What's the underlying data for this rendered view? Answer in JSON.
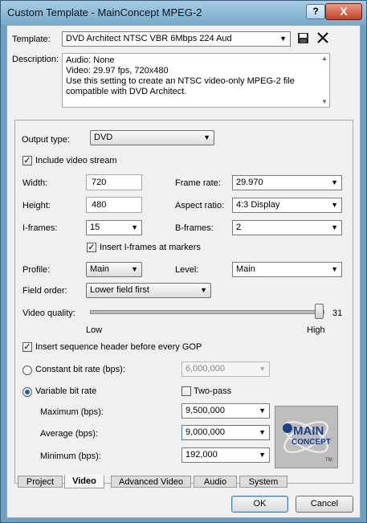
{
  "window": {
    "title": "Custom Template - MainConcept MPEG-2",
    "help_glyph": "?",
    "close_glyph": "X"
  },
  "template": {
    "label": "Template:",
    "value": "DVD Architect NTSC VBR 6Mbps 224 Aud"
  },
  "description": {
    "label": "Description:",
    "lines": [
      "Audio: None",
      "Video: 29.97 fps, 720x480",
      "Use this setting to create an NTSC video-only MPEG-2 file",
      "compatible with DVD Architect."
    ]
  },
  "output_type": {
    "label": "Output type:",
    "value": "DVD"
  },
  "include_video": {
    "label": "Include video stream",
    "checked": true
  },
  "width": {
    "label": "Width:",
    "value": "720"
  },
  "height": {
    "label": "Height:",
    "value": "480"
  },
  "frame_rate": {
    "label": "Frame rate:",
    "value": "29.970"
  },
  "aspect_ratio": {
    "label": "Aspect ratio:",
    "value": "4:3 Display"
  },
  "i_frames": {
    "label": "I-frames:",
    "value": "15"
  },
  "b_frames": {
    "label": "B-frames:",
    "value": "2"
  },
  "insert_iframes": {
    "label": "Insert I-frames at markers",
    "checked": true
  },
  "profile": {
    "label": "Profile:",
    "value": "Main"
  },
  "level": {
    "label": "Level:",
    "value": "Main"
  },
  "field_order": {
    "label": "Field order:",
    "value": "Lower field first"
  },
  "video_quality": {
    "label": "Video quality:",
    "value": "31",
    "low": "Low",
    "high": "High",
    "level_fraction": 1.0
  },
  "insert_seq_header": {
    "label": "Insert sequence header before every GOP",
    "checked": true
  },
  "constant_bitrate": {
    "label": "Constant bit rate (bps):",
    "value": "6,000,000",
    "selected": false
  },
  "variable_bitrate": {
    "label": "Variable bit rate",
    "selected": true
  },
  "two_pass": {
    "label": "Two-pass",
    "checked": false
  },
  "maximum": {
    "label": "Maximum (bps):",
    "value": "9,500,000"
  },
  "average": {
    "label": "Average (bps):",
    "value": "9,000,000"
  },
  "minimum": {
    "label": "Minimum (bps):",
    "value": "192,000"
  },
  "logo": {
    "line1": "MAIN",
    "line2": "CONCEPT",
    "tm": "TM"
  },
  "tabs": [
    {
      "label": "Project",
      "active": false
    },
    {
      "label": "Video",
      "active": true
    },
    {
      "label": "Advanced Video",
      "active": false
    },
    {
      "label": "Audio",
      "active": false
    },
    {
      "label": "System",
      "active": false
    }
  ],
  "buttons": {
    "ok": "OK",
    "cancel": "Cancel"
  },
  "colors": {
    "title_gradient_top": "#a7cde6",
    "close_red": "#c2412a",
    "radio_blue": "#1d5da8"
  }
}
